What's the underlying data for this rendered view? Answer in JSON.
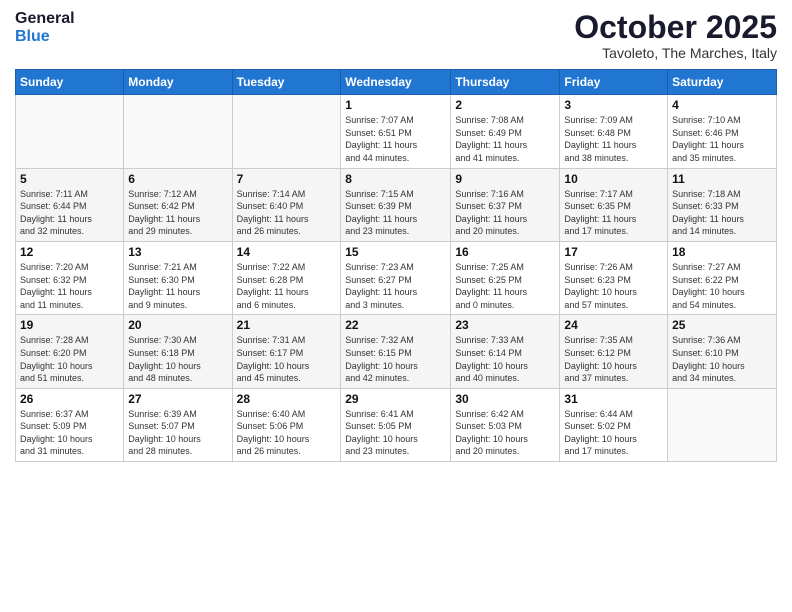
{
  "header": {
    "logo_line1": "General",
    "logo_line2": "Blue",
    "month_title": "October 2025",
    "subtitle": "Tavoleto, The Marches, Italy"
  },
  "days_of_week": [
    "Sunday",
    "Monday",
    "Tuesday",
    "Wednesday",
    "Thursday",
    "Friday",
    "Saturday"
  ],
  "weeks": [
    [
      {
        "day": "",
        "info": ""
      },
      {
        "day": "",
        "info": ""
      },
      {
        "day": "",
        "info": ""
      },
      {
        "day": "1",
        "info": "Sunrise: 7:07 AM\nSunset: 6:51 PM\nDaylight: 11 hours\nand 44 minutes."
      },
      {
        "day": "2",
        "info": "Sunrise: 7:08 AM\nSunset: 6:49 PM\nDaylight: 11 hours\nand 41 minutes."
      },
      {
        "day": "3",
        "info": "Sunrise: 7:09 AM\nSunset: 6:48 PM\nDaylight: 11 hours\nand 38 minutes."
      },
      {
        "day": "4",
        "info": "Sunrise: 7:10 AM\nSunset: 6:46 PM\nDaylight: 11 hours\nand 35 minutes."
      }
    ],
    [
      {
        "day": "5",
        "info": "Sunrise: 7:11 AM\nSunset: 6:44 PM\nDaylight: 11 hours\nand 32 minutes."
      },
      {
        "day": "6",
        "info": "Sunrise: 7:12 AM\nSunset: 6:42 PM\nDaylight: 11 hours\nand 29 minutes."
      },
      {
        "day": "7",
        "info": "Sunrise: 7:14 AM\nSunset: 6:40 PM\nDaylight: 11 hours\nand 26 minutes."
      },
      {
        "day": "8",
        "info": "Sunrise: 7:15 AM\nSunset: 6:39 PM\nDaylight: 11 hours\nand 23 minutes."
      },
      {
        "day": "9",
        "info": "Sunrise: 7:16 AM\nSunset: 6:37 PM\nDaylight: 11 hours\nand 20 minutes."
      },
      {
        "day": "10",
        "info": "Sunrise: 7:17 AM\nSunset: 6:35 PM\nDaylight: 11 hours\nand 17 minutes."
      },
      {
        "day": "11",
        "info": "Sunrise: 7:18 AM\nSunset: 6:33 PM\nDaylight: 11 hours\nand 14 minutes."
      }
    ],
    [
      {
        "day": "12",
        "info": "Sunrise: 7:20 AM\nSunset: 6:32 PM\nDaylight: 11 hours\nand 11 minutes."
      },
      {
        "day": "13",
        "info": "Sunrise: 7:21 AM\nSunset: 6:30 PM\nDaylight: 11 hours\nand 9 minutes."
      },
      {
        "day": "14",
        "info": "Sunrise: 7:22 AM\nSunset: 6:28 PM\nDaylight: 11 hours\nand 6 minutes."
      },
      {
        "day": "15",
        "info": "Sunrise: 7:23 AM\nSunset: 6:27 PM\nDaylight: 11 hours\nand 3 minutes."
      },
      {
        "day": "16",
        "info": "Sunrise: 7:25 AM\nSunset: 6:25 PM\nDaylight: 11 hours\nand 0 minutes."
      },
      {
        "day": "17",
        "info": "Sunrise: 7:26 AM\nSunset: 6:23 PM\nDaylight: 10 hours\nand 57 minutes."
      },
      {
        "day": "18",
        "info": "Sunrise: 7:27 AM\nSunset: 6:22 PM\nDaylight: 10 hours\nand 54 minutes."
      }
    ],
    [
      {
        "day": "19",
        "info": "Sunrise: 7:28 AM\nSunset: 6:20 PM\nDaylight: 10 hours\nand 51 minutes."
      },
      {
        "day": "20",
        "info": "Sunrise: 7:30 AM\nSunset: 6:18 PM\nDaylight: 10 hours\nand 48 minutes."
      },
      {
        "day": "21",
        "info": "Sunrise: 7:31 AM\nSunset: 6:17 PM\nDaylight: 10 hours\nand 45 minutes."
      },
      {
        "day": "22",
        "info": "Sunrise: 7:32 AM\nSunset: 6:15 PM\nDaylight: 10 hours\nand 42 minutes."
      },
      {
        "day": "23",
        "info": "Sunrise: 7:33 AM\nSunset: 6:14 PM\nDaylight: 10 hours\nand 40 minutes."
      },
      {
        "day": "24",
        "info": "Sunrise: 7:35 AM\nSunset: 6:12 PM\nDaylight: 10 hours\nand 37 minutes."
      },
      {
        "day": "25",
        "info": "Sunrise: 7:36 AM\nSunset: 6:10 PM\nDaylight: 10 hours\nand 34 minutes."
      }
    ],
    [
      {
        "day": "26",
        "info": "Sunrise: 6:37 AM\nSunset: 5:09 PM\nDaylight: 10 hours\nand 31 minutes."
      },
      {
        "day": "27",
        "info": "Sunrise: 6:39 AM\nSunset: 5:07 PM\nDaylight: 10 hours\nand 28 minutes."
      },
      {
        "day": "28",
        "info": "Sunrise: 6:40 AM\nSunset: 5:06 PM\nDaylight: 10 hours\nand 26 minutes."
      },
      {
        "day": "29",
        "info": "Sunrise: 6:41 AM\nSunset: 5:05 PM\nDaylight: 10 hours\nand 23 minutes."
      },
      {
        "day": "30",
        "info": "Sunrise: 6:42 AM\nSunset: 5:03 PM\nDaylight: 10 hours\nand 20 minutes."
      },
      {
        "day": "31",
        "info": "Sunrise: 6:44 AM\nSunset: 5:02 PM\nDaylight: 10 hours\nand 17 minutes."
      },
      {
        "day": "",
        "info": ""
      }
    ]
  ]
}
